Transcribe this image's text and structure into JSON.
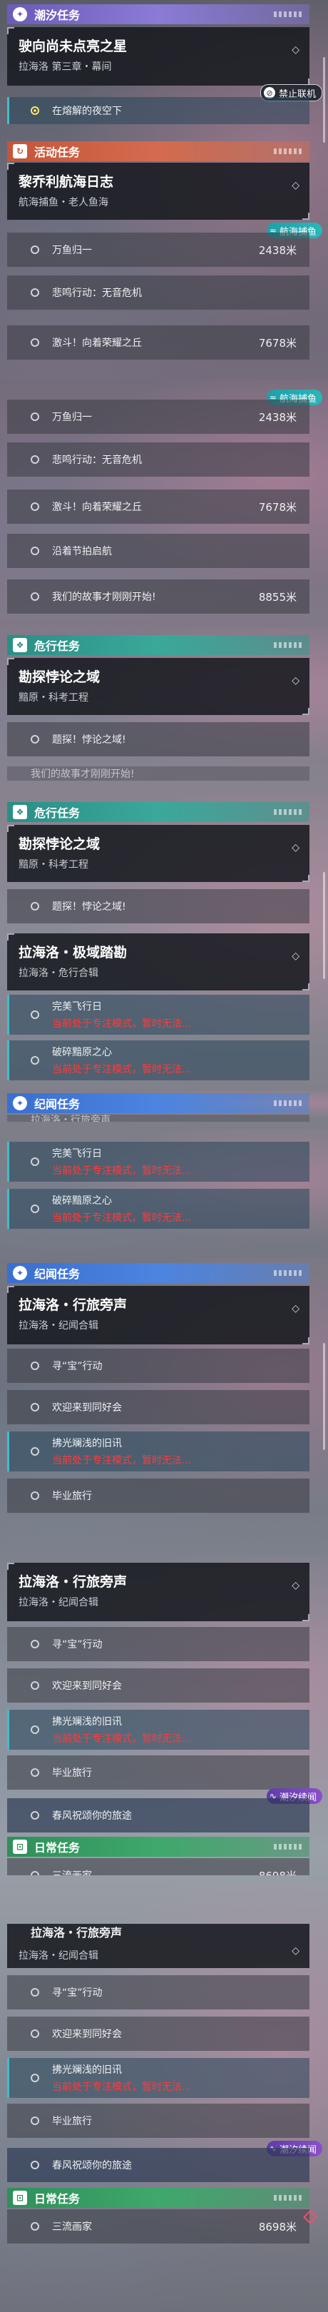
{
  "sections": {
    "tide": {
      "label": "潮汐任务",
      "icon": "✦"
    },
    "event": {
      "label": "活动任务",
      "icon": "↻"
    },
    "danger": {
      "label": "危行任务",
      "icon": "❖"
    },
    "chron": {
      "label": "纪闻任务",
      "icon": "✦"
    },
    "daily": {
      "label": "日常任务",
      "icon": "⊡"
    }
  },
  "tide_quest": {
    "title": "驶向尚未点亮之星",
    "subtitle": "拉海洛 第三章・幕间",
    "corner": "◇",
    "step": "在熔解的夜空下",
    "tag": "禁止联机"
  },
  "event_quest": {
    "title": "黎乔利航海日志",
    "subtitle": "航海捕鱼・老人鱼海",
    "corner": "◇",
    "tag": "航海捕鱼",
    "steps": [
      {
        "label": "万鱼归一",
        "dist": "2438米"
      },
      {
        "label": "悲鸣行动：无音危机",
        "dist": ""
      },
      {
        "label": "激斗！向着荣耀之丘",
        "dist": "7678米"
      },
      {
        "label": "沿着节拍启航",
        "dist": ""
      },
      {
        "label": "我们的故事才刚刚开始!",
        "dist": "8855米"
      }
    ]
  },
  "danger_quest": {
    "title": "勘探悖论之域",
    "subtitle": "黯原・科考工程",
    "corner": "◇",
    "step": "题探！悖论之域!",
    "partial": "我们的故事才刚刚开始!"
  },
  "chron_extreme": {
    "title": "拉海洛・极域踏勘",
    "subtitle": "拉海洛・危行合辑",
    "corner": "◇",
    "steps": [
      {
        "label": "完美飞行日",
        "warn": "当前处于专注模式，暂时无法..."
      },
      {
        "label": "破碎黯原之心",
        "warn": "当前处于专注模式，暂时无法..."
      }
    ],
    "partial": "拉海洛・行旅旁声"
  },
  "chron_travel": {
    "title": "拉海洛・行旅旁声",
    "subtitle": "拉海洛・纪闻合辑",
    "corner": "◇",
    "steps": [
      {
        "label": "寻“宝”行动",
        "warn": ""
      },
      {
        "label": "欢迎来到同好会",
        "warn": ""
      },
      {
        "label": "拂光斓浅的旧讯",
        "warn": "当前处于专注模式，暂时无法..."
      },
      {
        "label": "毕业旅行",
        "warn": ""
      }
    ],
    "partial": "拉海洛・行旅旁声"
  },
  "spring": {
    "label": "春风祝颂你的旅途",
    "tag": "潮汐续闻"
  },
  "daily_quest": {
    "label": "三流画家",
    "dist": "8698米"
  },
  "colors": {
    "warn": "#ff3b3b",
    "accent": "#3ec0c8"
  }
}
